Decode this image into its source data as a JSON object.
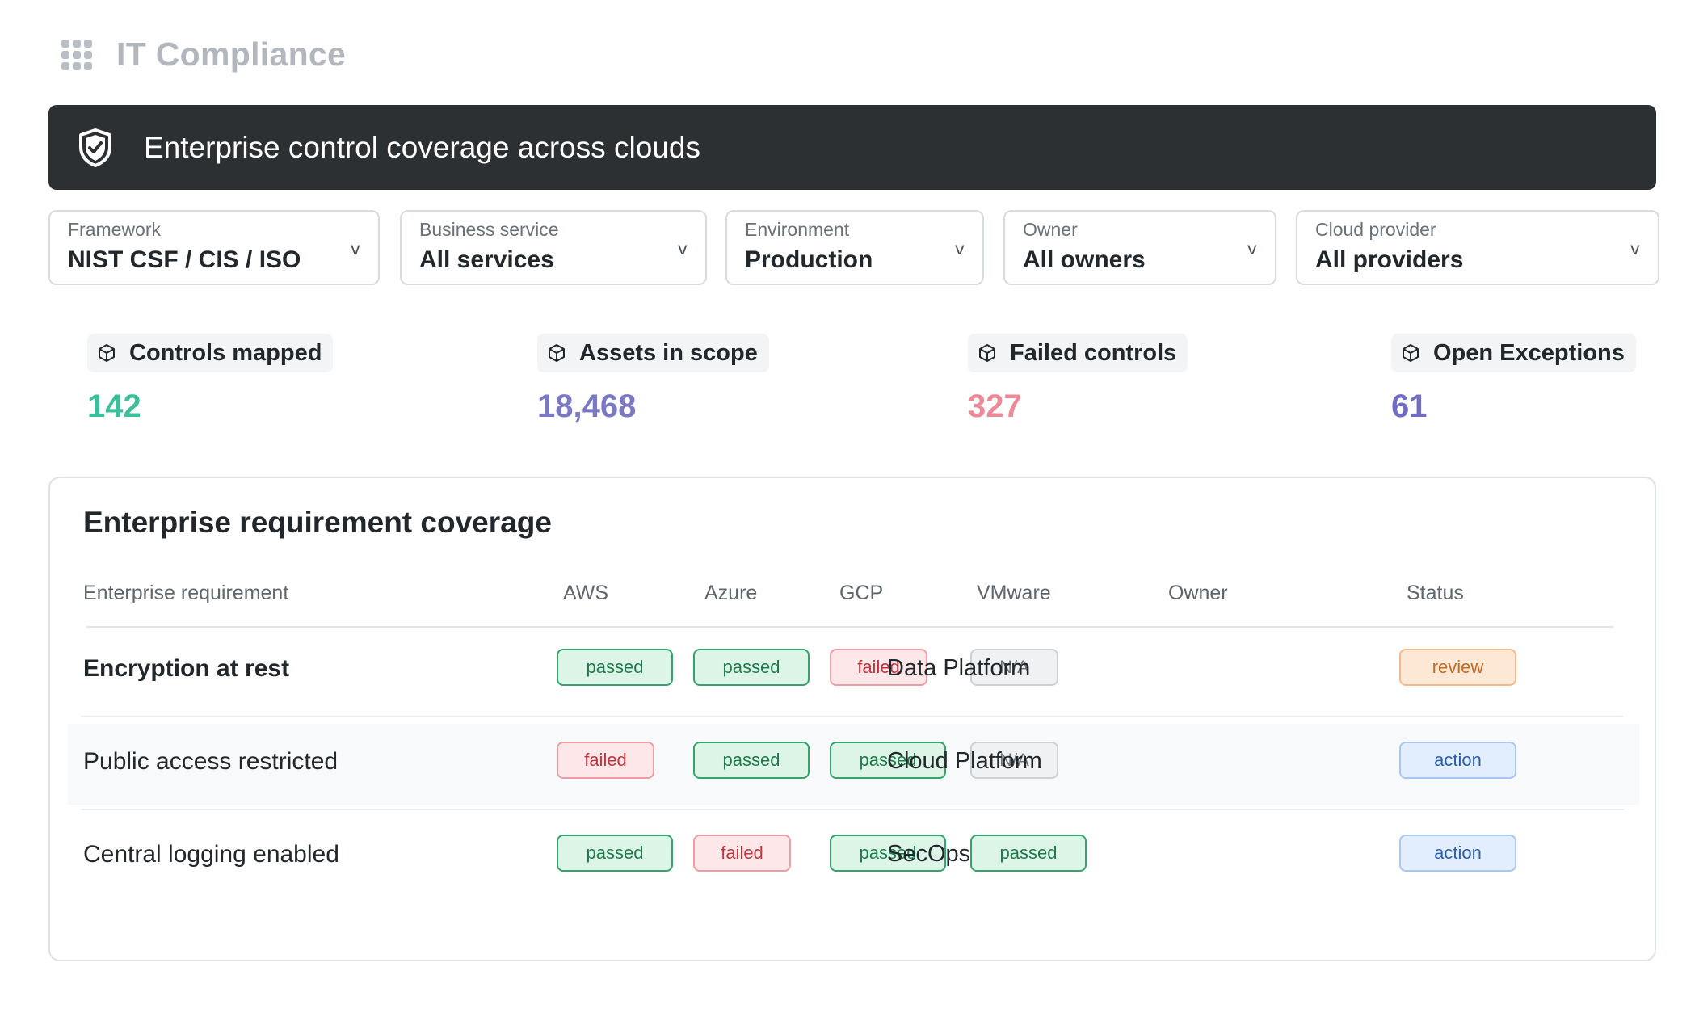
{
  "app": {
    "title": "IT Compliance",
    "icon": "apps-grid-icon"
  },
  "banner": {
    "title": "Enterprise control coverage across clouds",
    "icon": "shield-check-icon"
  },
  "filters": [
    {
      "label": "Framework",
      "value": "NIST CSF / CIS / ISO"
    },
    {
      "label": "Business service",
      "value": "All services"
    },
    {
      "label": "Environment",
      "value": "Production"
    },
    {
      "label": "Owner",
      "value": "All owners"
    },
    {
      "label": "Cloud provider",
      "value": "All providers"
    }
  ],
  "filter_chevron": "v",
  "kpis": [
    {
      "title": "Controls mapped",
      "value": "142",
      "color": "#3dbf9c",
      "icon": "cube-icon"
    },
    {
      "title": "Assets in scope",
      "value": "18,468",
      "color": "#7b78c4",
      "icon": "cube-icon"
    },
    {
      "title": "Failed controls",
      "value": "327",
      "color": "#ee8a97",
      "icon": "cube-icon"
    },
    {
      "title": "Open Exceptions",
      "value": "61",
      "color": "#6f6cc2",
      "icon": "cube-icon"
    }
  ],
  "coverage": {
    "title": "Enterprise requirement coverage",
    "columns": [
      "Enterprise requirement",
      "AWS",
      "Azure",
      "GCP",
      "VMware",
      "Owner",
      "Status"
    ],
    "rows": [
      {
        "requirement": "Encryption at rest",
        "aws": "passed",
        "azure": "passed",
        "gcp": "failed",
        "vmware": "N/A",
        "owner": "Data Platform",
        "status": "review"
      },
      {
        "requirement": "Public access restricted",
        "aws": "failed",
        "azure": "passed",
        "gcp": "passed",
        "vmware": "N/A",
        "owner": "Cloud Platform",
        "status": "action"
      },
      {
        "requirement": "Central logging enabled",
        "aws": "passed",
        "azure": "failed",
        "gcp": "passed",
        "vmware": "passed",
        "owner": "SecOps",
        "status": "action"
      }
    ]
  },
  "colors": {
    "banner_bg": "#2c3033",
    "passed": "#1d7c4b",
    "failed": "#c2323c",
    "na": "#6b7277",
    "review": "#c26a22",
    "action": "#2a5fae"
  }
}
